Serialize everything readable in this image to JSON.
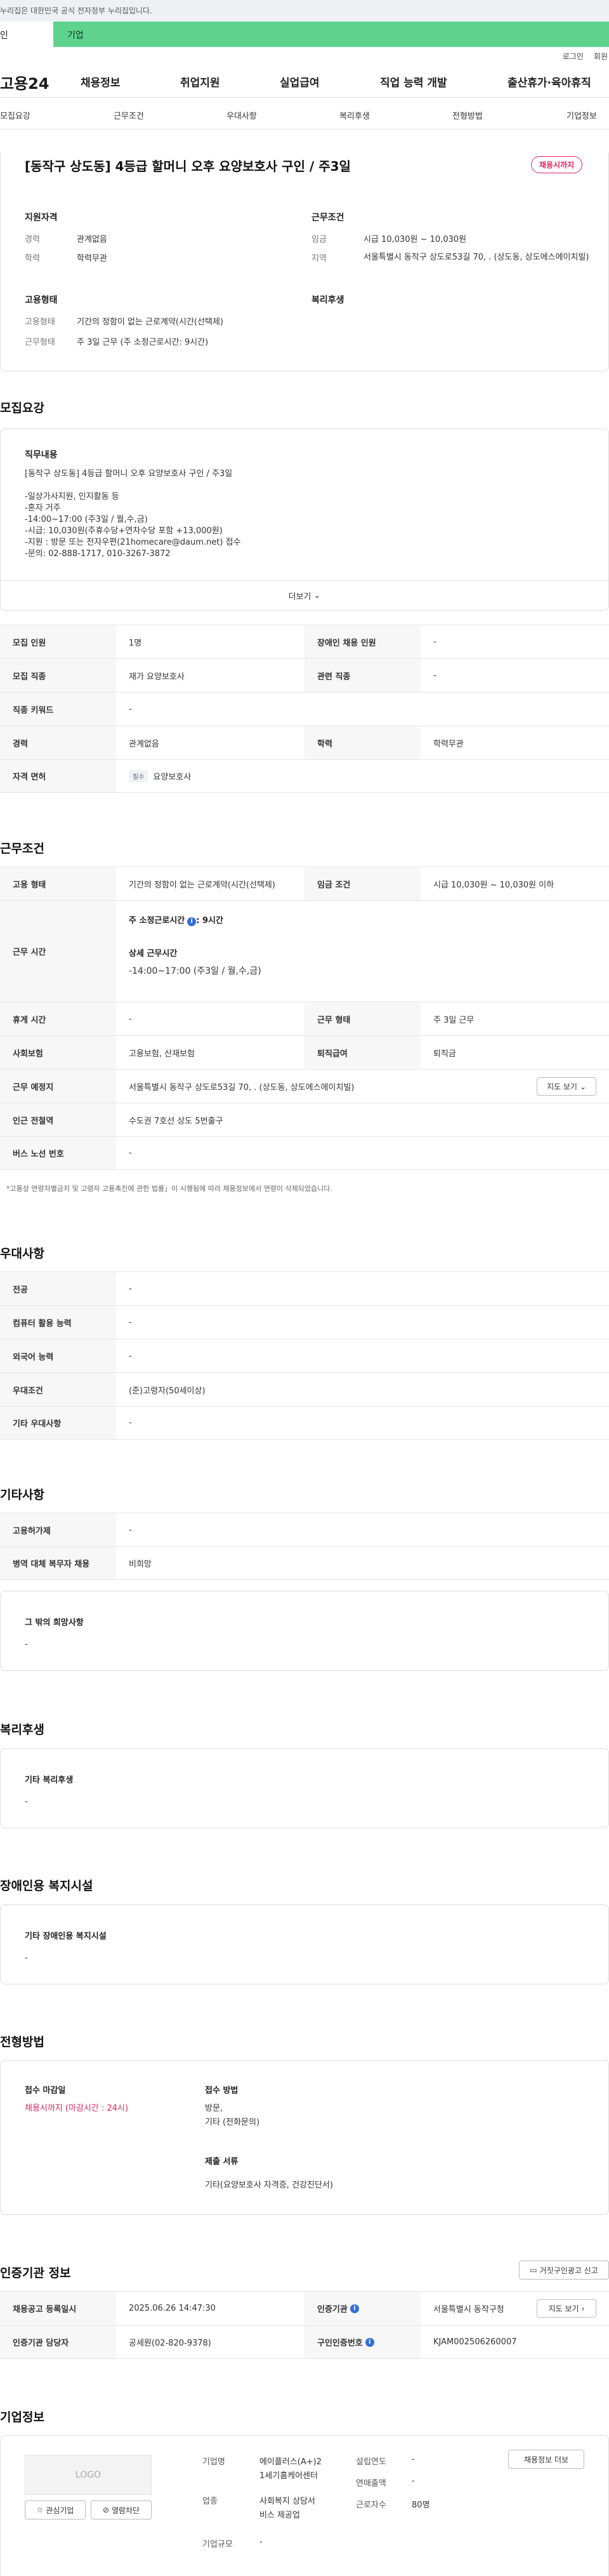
{
  "gov_bar": {
    "text": "누리집은 대한민국 공식 전자정부 누리집입니다."
  },
  "top_tabs": {
    "individual": "인",
    "company": "기업"
  },
  "util": {
    "login": "로그인",
    "join": "회원"
  },
  "gnb": {
    "logo": "고용24",
    "items": [
      "채용정보",
      "취업지원",
      "실업급여",
      "직업 능력 개발",
      "출산휴가·육아휴직"
    ]
  },
  "anchor": [
    "모집요강",
    "근무조건",
    "우대사항",
    "복리후생",
    "전형방법",
    "기업정보"
  ],
  "summary": {
    "title": "[동작구 상도동] 4등급 할머니 오후 요양보호사 구인 / 주3일",
    "badge": "채용시까지",
    "qual_title": "지원자격",
    "qual_rows": [
      {
        "label": "경력",
        "value": "관계없음"
      },
      {
        "label": "학력",
        "value": "학력무관"
      }
    ],
    "cond_title": "근무조건",
    "cond_rows": [
      {
        "label": "임금",
        "value": "시급 10,030원 ~ 10,030원"
      },
      {
        "label": "지역",
        "value": "서울특별시 동작구 상도로53길 70, . (상도동, 상도에스에이치빌)"
      }
    ],
    "emp_title": "고용형태",
    "emp_rows": [
      {
        "label": "고용형태",
        "value": "기간의 정함이 없는 근로계약(시간(선택제)"
      },
      {
        "label": "근무형태",
        "value": "주 3일 근무 (주 소정근로시간: 9시간)"
      }
    ],
    "welfare_title": "복리후생"
  },
  "recruit": {
    "heading": "모집요강",
    "duty_title": "직무내용",
    "duty_lines": [
      "[동작구 상도동] 4등급 할머니 오후 요양보호사 구인 / 주3일",
      "",
      "-일상가사지원, 인지활동 등",
      "-혼자 거주",
      "-14:00~17:00 (주3일 / 월,수,금)",
      "-시급: 10,030원(주휴수당+연차수당 포함 +13,000원)",
      "-지원 : 방문 또는 전자우편(21homecare@daum.net) 접수",
      "-문의: 02-888-1717,  010-3267-3872"
    ],
    "more": "더보기",
    "table": {
      "r1": {
        "h1": "모집 인원",
        "v1": "1명",
        "h2": "장애인 채용 인원",
        "v2": "-"
      },
      "r2": {
        "h1": "모집 직종",
        "v1": "재가 요양보호사",
        "h2": "관련 직종",
        "v2": "-"
      },
      "r3": {
        "h1": "직종 키워드",
        "v1": "-"
      },
      "r4": {
        "h1": "경력",
        "v1": "관계없음",
        "h2": "학력",
        "v2": "학력무관"
      },
      "r5": {
        "h1": "자격 면허",
        "chip": "필수",
        "v1": "요양보호사"
      }
    }
  },
  "work": {
    "heading": "근무조건",
    "r1": {
      "h1": "고용 형태",
      "v1": "기간의 정함이 없는 근로계약(시간(선택제)",
      "h2": "임금 조건",
      "v2": "시급 10,030원 ~ 10,030원 이하"
    },
    "hours": {
      "h": "근무 시간",
      "weekly": "주 소정근로시간",
      "weekly_val": ": 9시간",
      "detail_title": "상세 근무시간",
      "detail": "-14:00~17:00 (주3일 / 월,수,금)"
    },
    "r3": {
      "h1": "휴게 시간",
      "v1": "-",
      "h2": "근무 형태",
      "v2": "주 3일 근무"
    },
    "r4": {
      "h1": "사회보험",
      "v1": "고용보험, 산재보험",
      "h2": "퇴직급여",
      "v2": "퇴직금"
    },
    "r5": {
      "h1": "근무 예정지",
      "v1": "서울특별시 동작구 상도로53길 70, . (상도동, 상도에스에이치빌)",
      "btn": "지도 보기"
    },
    "r6": {
      "h1": "인근 전철역",
      "v1": "수도권 7호선 상도 5번출구"
    },
    "r7": {
      "h1": "버스 노선 번호",
      "v1": "-"
    },
    "note": "*고용상 연령차별금지 및 고령자 고용촉진에 관한 법률」이 시행됨에 따라 채용정보에서 연령이 삭제되었습니다."
  },
  "prefer": {
    "heading": "우대사항",
    "rows": [
      {
        "h": "전공",
        "v": "-"
      },
      {
        "h": "컴퓨터 활용 능력",
        "v": "-"
      },
      {
        "h": "외국어 능력",
        "v": "-"
      },
      {
        "h": "우대조건",
        "v": "(준)고령자(50세이상)"
      },
      {
        "h": "기타 우대사항",
        "v": "-"
      }
    ]
  },
  "etc": {
    "heading": "기타사항",
    "rows": [
      {
        "h": "고용허가제",
        "v": "-"
      },
      {
        "h": "병역 대체 복무자 채용",
        "v": "비희망"
      }
    ],
    "other_title": "그 밖의 희망사항",
    "other_val": "-"
  },
  "welfare": {
    "heading": "복리후생",
    "title": "기타 복리후생",
    "val": "-"
  },
  "disab": {
    "heading": "장애인용 복지시설",
    "title": "기타 장애인용 복지시설",
    "val": "-"
  },
  "process": {
    "heading": "전형방법",
    "deadline_title": "접수 마감일",
    "deadline": "채용시까지 (마감시간 : 24시)",
    "method_title": "접수 방법",
    "methods": [
      "방문,",
      "기타 (전화문의)"
    ],
    "docs_title": "제출 서류",
    "docs": "기타(요양보호사 자격증, 건강진단서)"
  },
  "agency": {
    "heading": "인증기관 정보",
    "report_btn": "거짓구인광고 신고",
    "r1": {
      "h1": "채용공고 등록일시",
      "v1": "2025.06.26 14:47:30",
      "h2": "인증기관",
      "v2": "서울특별시 동작구청",
      "btn": "지도 보기"
    },
    "r2": {
      "h1": "인증기관 담당자",
      "v1": "공세원(02-820-9378)",
      "h2": "구인인증번호",
      "v2": "KJAM002506260007"
    }
  },
  "company": {
    "heading": "기업정보",
    "logo": "LOGO",
    "fav": "관심기업",
    "block": "열람차단",
    "name_label": "기업명",
    "name": "에이플러스(A+)2",
    "name2": "1세기홈케어센터",
    "industry_label": "업종",
    "industry": "사회복지 상담서",
    "industry2": "비스 제공업",
    "size_label": "기업규모",
    "size": "-",
    "founded_label": "설립연도",
    "founded": "-",
    "sales_label": "연매출액",
    "sales": "-",
    "staff_label": "근로자수",
    "staff": "80명",
    "more_btn": "채용정보 더보"
  },
  "colors": {
    "accent_green": "#5fd38d",
    "badge_red": "#e0245e",
    "info_blue": "#2f6fdb"
  }
}
